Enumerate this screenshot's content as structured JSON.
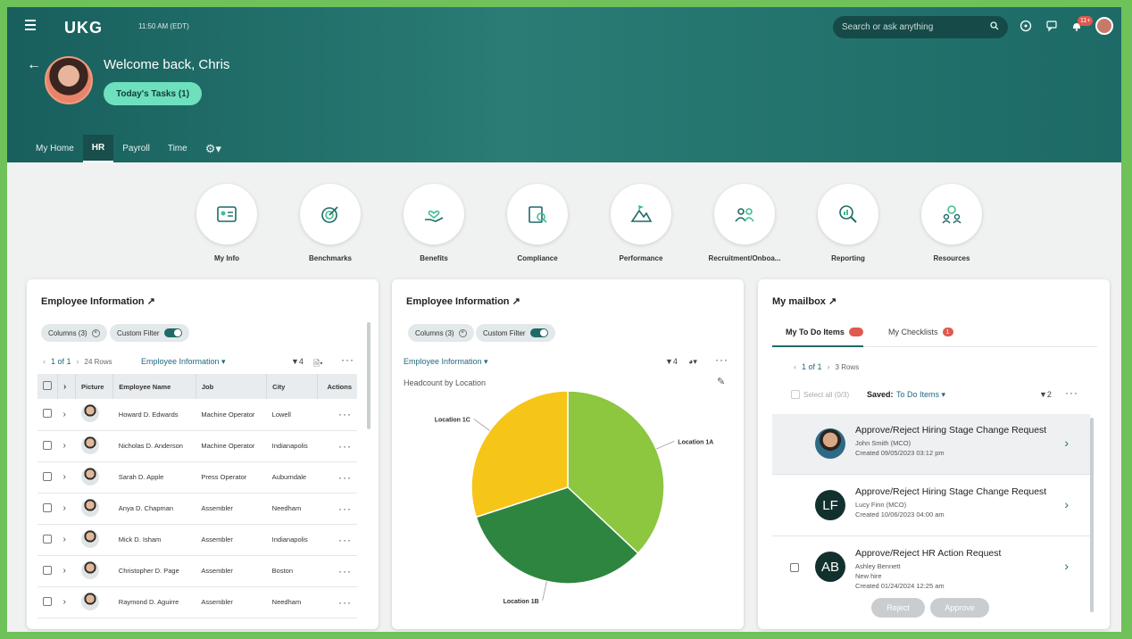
{
  "header": {
    "logo": "UKG",
    "time": "11:50 AM (EDT)",
    "search_placeholder": "Search or ask anything",
    "notification_count": "11+",
    "welcome": "Welcome back, Chris",
    "tasks_button": "Today's Tasks (1)"
  },
  "nav": {
    "tabs": [
      "My Home",
      "HR",
      "Payroll",
      "Time"
    ],
    "active": "HR"
  },
  "quick_links": [
    "My Info",
    "Benchmarks",
    "Benefits",
    "Compliance",
    "Performance",
    "Recruitment/Onboa...",
    "Reporting",
    "Resources"
  ],
  "employee_table": {
    "title": "Employee Information ↗",
    "columns_chip": "Columns (3)",
    "filter_chip": "Custom Filter",
    "pager": "1 of 1",
    "rows_count": "24 Rows",
    "view": "Employee Information",
    "filter_count": "4",
    "headers": [
      "Picture",
      "Employee Name",
      "Job",
      "City",
      "Actions"
    ],
    "rows": [
      {
        "name": "Howard D. Edwards",
        "job": "Machine Operator",
        "city": "Lowell"
      },
      {
        "name": "Nicholas D. Anderson",
        "job": "Machine Operator",
        "city": "Indianapolis"
      },
      {
        "name": "Sarah D. Apple",
        "job": "Press Operator",
        "city": "Auburndale"
      },
      {
        "name": "Anya D. Chapman",
        "job": "Assembler",
        "city": "Needham"
      },
      {
        "name": "Mick D. Isham",
        "job": "Assembler",
        "city": "Indianapolis"
      },
      {
        "name": "Christopher D. Page",
        "job": "Assembler",
        "city": "Boston"
      },
      {
        "name": "Raymond D. Aguirre",
        "job": "Assembler",
        "city": "Needham"
      }
    ]
  },
  "chart_card": {
    "title": "Employee Information ↗",
    "columns_chip": "Columns (3)",
    "filter_chip": "Custom Filter",
    "view": "Employee Information",
    "filter_count": "4",
    "subtitle": "Headcount by Location"
  },
  "chart_data": {
    "type": "pie",
    "title": "Headcount by Location",
    "categories": [
      "Location 1A",
      "Location 1B",
      "Location 1C"
    ],
    "values": [
      37,
      33,
      30
    ],
    "colors": [
      "#8dc63f",
      "#2e8540",
      "#f5c518"
    ]
  },
  "mailbox": {
    "title": "My mailbox ↗",
    "tab_todo": "My To Do Items",
    "tab_checklists": "My Checklists",
    "checklists_count": "1",
    "pager": "1 of 1",
    "rows_count": "3 Rows",
    "select_all": "Select all (0/3)",
    "saved_label": "Saved:",
    "saved_value": "To Do Items",
    "filter_count": "2",
    "items": [
      {
        "title": "Approve/Reject Hiring Stage Change Request",
        "line1": "John Smith (MCO)",
        "line2": "Created 09/05/2023 03:12 pm",
        "initials": ""
      },
      {
        "title": "Approve/Reject Hiring Stage Change Request",
        "line1": "Lucy Finn (MCO)",
        "line2": "Created 10/06/2023 04:00 am",
        "initials": "LF"
      },
      {
        "title": "Approve/Reject HR Action Request",
        "line1": "Ashley Bennett",
        "line1b": "New hire",
        "line2": "Created 01/24/2024 12:25 am",
        "initials": "AB"
      }
    ],
    "reject": "Reject",
    "approve": "Approve"
  }
}
